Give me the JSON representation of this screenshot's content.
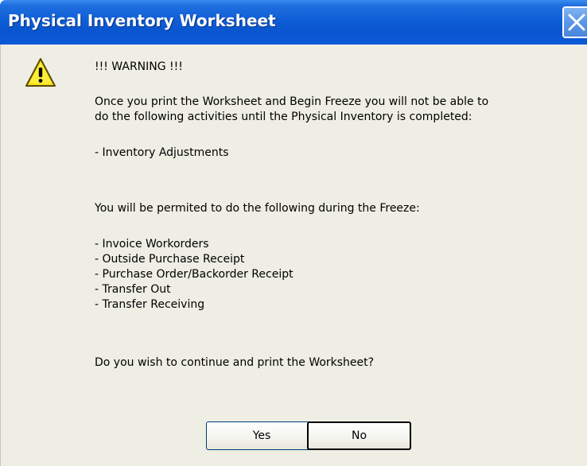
{
  "window": {
    "title": "Physical Inventory Worksheet",
    "close_icon": "close-icon"
  },
  "dialog": {
    "icon": "warning-icon",
    "warning_heading": "!!! WARNING !!!",
    "intro_line1": "Once you print the Worksheet and Begin Freeze you will not be able to",
    "intro_line2": "do the following activities until the Physical Inventory is completed:",
    "blocked_items": [
      "- Inventory Adjustments"
    ],
    "permitted_intro": "You will be permited to do the following during the Freeze:",
    "permitted_items": [
      "- Invoice Workorders",
      "- Outside Purchase Receipt",
      "- Purchase Order/Backorder Receipt",
      "- Transfer Out",
      "- Transfer Receiving"
    ],
    "question": "Do you wish to continue and print the Worksheet?"
  },
  "buttons": {
    "yes_label": "Yes",
    "no_label": "No"
  }
}
